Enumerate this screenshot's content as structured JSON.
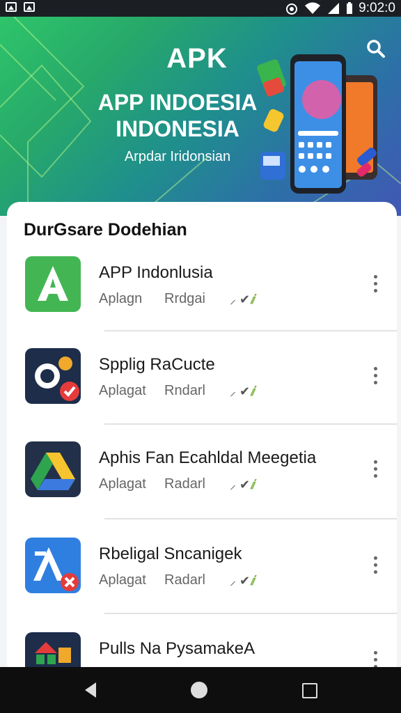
{
  "status_bar": {
    "time": "9:02:0"
  },
  "header": {
    "title": "APK",
    "heading_line1": "APP INDOESIA",
    "heading_line2": "INDONESIA",
    "subtitle": "Arpdar Iridonsian"
  },
  "section": {
    "title": "DurGsare Dodehian"
  },
  "apps": [
    {
      "name": "APP Indonlusia",
      "category": "Aplagn",
      "tag": "Rrdgai"
    },
    {
      "name": "Spplig RaCucte",
      "category": "Aplagat",
      "tag": "Rndarl"
    },
    {
      "name": "Aphis Fan Ecahldal Meegetia",
      "category": "Aplagat",
      "tag": "Radarl"
    },
    {
      "name": "Rbeligal Sncanigek",
      "category": "Aplagat",
      "tag": "Radarl"
    },
    {
      "name": "Pulls Na PysamakeA",
      "category": "",
      "tag": ""
    }
  ],
  "rating_glyph": "ⅈ",
  "colors": {
    "hero_start": "#2ec56a",
    "hero_end": "#4257b5",
    "accent_green": "#4cae4f",
    "nav_bar": "#0e0e0e"
  },
  "icons": [
    "image-icon",
    "alarm-icon",
    "wifi-icon",
    "signal-icon",
    "search-icon",
    "more-vert-icon",
    "back-icon",
    "home-icon",
    "recents-icon"
  ]
}
